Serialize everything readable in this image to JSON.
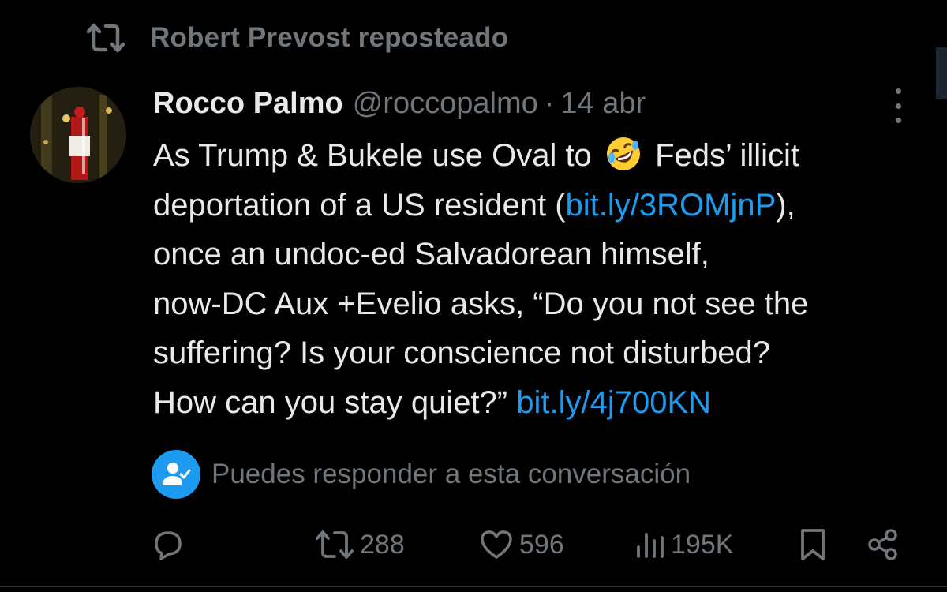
{
  "repost": {
    "text": "Robert Prevost reposteado",
    "icon": "repost-icon"
  },
  "tweet": {
    "author_name": "Rocco Palmo",
    "handle": "@roccopalmo",
    "separator": "·",
    "date": "14 abr",
    "body": {
      "l1_a": "As Trump & Bukele use Oval to",
      "l1_emoji": "rolling-on-floor-laughing-emoji",
      "l1_b": "Feds’ illicit",
      "l2_a": "deportation of a US resident (",
      "l2_link": "bit.ly/3ROMjnP",
      "l2_b": "),",
      "l3": "once an undoc-ed Salvadorean himself,",
      "l4": "now-DC Aux +Evelio asks, “Do you not see the",
      "l5": "suffering? Is your conscience not disturbed?",
      "l6_a": "How can you stay quiet?”",
      "l6_link": "bit.ly/4j700KN"
    },
    "reply_notice": "Puedes responder a esta conversación"
  },
  "actions": {
    "reply": {
      "icon": "reply-icon",
      "count": ""
    },
    "repost": {
      "icon": "repost-icon",
      "count": "288"
    },
    "like": {
      "icon": "heart-icon",
      "count": "596"
    },
    "views": {
      "icon": "views-icon",
      "count": "195K"
    },
    "bookmark": {
      "icon": "bookmark-icon"
    },
    "share": {
      "icon": "share-icon"
    }
  },
  "colors": {
    "background": "#000000",
    "text": "#e7e9ea",
    "muted": "#71767b",
    "accent": "#1d9bf0"
  }
}
